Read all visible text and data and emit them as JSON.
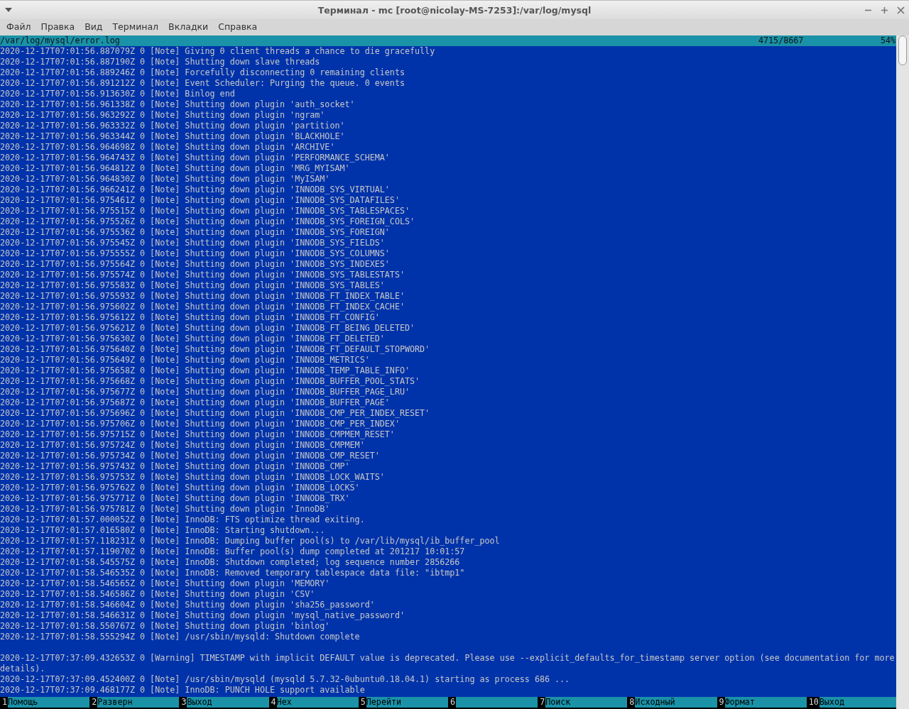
{
  "window": {
    "title": "Терминал - mc [root@nicolay-MS-7253]:/var/log/mysql"
  },
  "menu": [
    "Файл",
    "Правка",
    "Вид",
    "Терминал",
    "Вкладки",
    "Справка"
  ],
  "viewer_header": {
    "path": "/var/log/mysql/error.log",
    "position": "4715/8667",
    "percent": "54%"
  },
  "lines": [
    {
      "kind": "line",
      "text": "2020-12-17T07:01:56.887079Z 0 [Note] Giving 0 client threads a chance to die gracefully"
    },
    {
      "kind": "line",
      "text": "2020-12-17T07:01:56.887190Z 0 [Note] Shutting down slave threads"
    },
    {
      "kind": "line",
      "text": "2020-12-17T07:01:56.889246Z 0 [Note] Forcefully disconnecting 0 remaining clients"
    },
    {
      "kind": "line",
      "text": "2020-12-17T07:01:56.891212Z 0 [Note] Event Scheduler: Purging the queue. 0 events"
    },
    {
      "kind": "line",
      "text": "2020-12-17T07:01:56.913630Z 0 [Note] Binlog end"
    },
    {
      "kind": "line",
      "text": "2020-12-17T07:01:56.961338Z 0 [Note] Shutting down plugin 'auth_socket'"
    },
    {
      "kind": "line",
      "text": "2020-12-17T07:01:56.963292Z 0 [Note] Shutting down plugin 'ngram'"
    },
    {
      "kind": "line",
      "text": "2020-12-17T07:01:56.963332Z 0 [Note] Shutting down plugin 'partition'"
    },
    {
      "kind": "line",
      "text": "2020-12-17T07:01:56.963344Z 0 [Note] Shutting down plugin 'BLACKHOLE'"
    },
    {
      "kind": "line",
      "text": "2020-12-17T07:01:56.964698Z 0 [Note] Shutting down plugin 'ARCHIVE'"
    },
    {
      "kind": "line",
      "text": "2020-12-17T07:01:56.964743Z 0 [Note] Shutting down plugin 'PERFORMANCE_SCHEMA'"
    },
    {
      "kind": "line",
      "text": "2020-12-17T07:01:56.964812Z 0 [Note] Shutting down plugin 'MRG_MYISAM'"
    },
    {
      "kind": "line",
      "text": "2020-12-17T07:01:56.964830Z 0 [Note] Shutting down plugin 'MyISAM'"
    },
    {
      "kind": "line",
      "text": "2020-12-17T07:01:56.966241Z 0 [Note] Shutting down plugin 'INNODB_SYS_VIRTUAL'"
    },
    {
      "kind": "line",
      "text": "2020-12-17T07:01:56.975461Z 0 [Note] Shutting down plugin 'INNODB_SYS_DATAFILES'"
    },
    {
      "kind": "line",
      "text": "2020-12-17T07:01:56.975515Z 0 [Note] Shutting down plugin 'INNODB_SYS_TABLESPACES'"
    },
    {
      "kind": "line",
      "text": "2020-12-17T07:01:56.975526Z 0 [Note] Shutting down plugin 'INNODB_SYS_FOREIGN_COLS'"
    },
    {
      "kind": "line",
      "text": "2020-12-17T07:01:56.975536Z 0 [Note] Shutting down plugin 'INNODB_SYS_FOREIGN'"
    },
    {
      "kind": "line",
      "text": "2020-12-17T07:01:56.975545Z 0 [Note] Shutting down plugin 'INNODB_SYS_FIELDS'"
    },
    {
      "kind": "line",
      "text": "2020-12-17T07:01:56.975555Z 0 [Note] Shutting down plugin 'INNODB_SYS_COLUMNS'"
    },
    {
      "kind": "line",
      "text": "2020-12-17T07:01:56.975564Z 0 [Note] Shutting down plugin 'INNODB_SYS_INDEXES'"
    },
    {
      "kind": "line",
      "text": "2020-12-17T07:01:56.975574Z 0 [Note] Shutting down plugin 'INNODB_SYS_TABLESTATS'"
    },
    {
      "kind": "line",
      "text": "2020-12-17T07:01:56.975583Z 0 [Note] Shutting down plugin 'INNODB_SYS_TABLES'"
    },
    {
      "kind": "line",
      "text": "2020-12-17T07:01:56.975593Z 0 [Note] Shutting down plugin 'INNODB_FT_INDEX_TABLE'"
    },
    {
      "kind": "line",
      "text": "2020-12-17T07:01:56.975602Z 0 [Note] Shutting down plugin 'INNODB_FT_INDEX_CACHE'"
    },
    {
      "kind": "line",
      "text": "2020-12-17T07:01:56.975612Z 0 [Note] Shutting down plugin 'INNODB_FT_CONFIG'"
    },
    {
      "kind": "line",
      "text": "2020-12-17T07:01:56.975621Z 0 [Note] Shutting down plugin 'INNODB_FT_BEING_DELETED'"
    },
    {
      "kind": "line",
      "text": "2020-12-17T07:01:56.975630Z 0 [Note] Shutting down plugin 'INNODB_FT_DELETED'"
    },
    {
      "kind": "line",
      "text": "2020-12-17T07:01:56.975640Z 0 [Note] Shutting down plugin 'INNODB_FT_DEFAULT_STOPWORD'"
    },
    {
      "kind": "line",
      "text": "2020-12-17T07:01:56.975649Z 0 [Note] Shutting down plugin 'INNODB_METRICS'"
    },
    {
      "kind": "line",
      "text": "2020-12-17T07:01:56.975658Z 0 [Note] Shutting down plugin 'INNODB_TEMP_TABLE_INFO'"
    },
    {
      "kind": "line",
      "text": "2020-12-17T07:01:56.975668Z 0 [Note] Shutting down plugin 'INNODB_BUFFER_POOL_STATS'"
    },
    {
      "kind": "line",
      "text": "2020-12-17T07:01:56.975677Z 0 [Note] Shutting down plugin 'INNODB_BUFFER_PAGE_LRU'"
    },
    {
      "kind": "line",
      "text": "2020-12-17T07:01:56.975687Z 0 [Note] Shutting down plugin 'INNODB_BUFFER_PAGE'"
    },
    {
      "kind": "line",
      "text": "2020-12-17T07:01:56.975696Z 0 [Note] Shutting down plugin 'INNODB_CMP_PER_INDEX_RESET'"
    },
    {
      "kind": "line",
      "text": "2020-12-17T07:01:56.975706Z 0 [Note] Shutting down plugin 'INNODB_CMP_PER_INDEX'"
    },
    {
      "kind": "line",
      "text": "2020-12-17T07:01:56.975715Z 0 [Note] Shutting down plugin 'INNODB_CMPMEM_RESET'"
    },
    {
      "kind": "line",
      "text": "2020-12-17T07:01:56.975724Z 0 [Note] Shutting down plugin 'INNODB_CMPMEM'"
    },
    {
      "kind": "line",
      "text": "2020-12-17T07:01:56.975734Z 0 [Note] Shutting down plugin 'INNODB_CMP_RESET'"
    },
    {
      "kind": "line",
      "text": "2020-12-17T07:01:56.975743Z 0 [Note] Shutting down plugin 'INNODB_CMP'"
    },
    {
      "kind": "line",
      "text": "2020-12-17T07:01:56.975753Z 0 [Note] Shutting down plugin 'INNODB_LOCK_WAITS'"
    },
    {
      "kind": "line",
      "text": "2020-12-17T07:01:56.975762Z 0 [Note] Shutting down plugin 'INNODB_LOCKS'"
    },
    {
      "kind": "line",
      "text": "2020-12-17T07:01:56.975771Z 0 [Note] Shutting down plugin 'INNODB_TRX'"
    },
    {
      "kind": "line",
      "text": "2020-12-17T07:01:56.975781Z 0 [Note] Shutting down plugin 'InnoDB'"
    },
    {
      "kind": "line",
      "text": "2020-12-17T07:01:57.000052Z 0 [Note] InnoDB: FTS optimize thread exiting."
    },
    {
      "kind": "line",
      "text": "2020-12-17T07:01:57.016580Z 0 [Note] InnoDB: Starting shutdown..."
    },
    {
      "kind": "line",
      "text": "2020-12-17T07:01:57.118231Z 0 [Note] InnoDB: Dumping buffer pool(s) to /var/lib/mysql/ib_buffer_pool"
    },
    {
      "kind": "line",
      "text": "2020-12-17T07:01:57.119070Z 0 [Note] InnoDB: Buffer pool(s) dump completed at 201217 10:01:57"
    },
    {
      "kind": "line",
      "text": "2020-12-17T07:01:58.545575Z 0 [Note] InnoDB: Shutdown completed; log sequence number 2856266"
    },
    {
      "kind": "line",
      "text": "2020-12-17T07:01:58.546535Z 0 [Note] InnoDB: Removed temporary tablespace data file: \"ibtmp1\""
    },
    {
      "kind": "line",
      "text": "2020-12-17T07:01:58.546565Z 0 [Note] Shutting down plugin 'MEMORY'"
    },
    {
      "kind": "line",
      "text": "2020-12-17T07:01:58.546586Z 0 [Note] Shutting down plugin 'CSV'"
    },
    {
      "kind": "line",
      "text": "2020-12-17T07:01:58.546604Z 0 [Note] Shutting down plugin 'sha256_password'"
    },
    {
      "kind": "line",
      "text": "2020-12-17T07:01:58.546631Z 0 [Note] Shutting down plugin 'mysql_native_password'"
    },
    {
      "kind": "line",
      "text": "2020-12-17T07:01:58.550767Z 0 [Note] Shutting down plugin 'binlog'"
    },
    {
      "kind": "line",
      "text": "2020-12-17T07:01:58.555294Z 0 [Note] /usr/sbin/mysqld: Shutdown complete"
    },
    {
      "kind": "blank"
    },
    {
      "kind": "line",
      "text": "2020-12-17T07:37:09.432653Z 0 [Warning] TIMESTAMP with implicit DEFAULT value is deprecated. Please use --explicit_defaults_for_timestamp server option (see documentation for more"
    },
    {
      "kind": "line",
      "text": "details)."
    },
    {
      "kind": "line",
      "text": "2020-12-17T07:37:09.452400Z 0 [Note] /usr/sbin/mysqld (mysqld 5.7.32-0ubuntu0.18.04.1) starting as process 686 ..."
    },
    {
      "kind": "line",
      "text": "2020-12-17T07:37:09.468177Z 0 [Note] InnoDB: PUNCH HOLE support available"
    }
  ],
  "function_keys": [
    {
      "number": "1",
      "label": "Помощь"
    },
    {
      "number": "2",
      "label": "Разверн"
    },
    {
      "number": "3",
      "label": "Выход"
    },
    {
      "number": "4",
      "label": "Hex"
    },
    {
      "number": "5",
      "label": "Перейти"
    },
    {
      "number": "6"
    },
    {
      "number": "7",
      "label": "Поиск"
    },
    {
      "number": "8",
      "label": "Исходный"
    },
    {
      "number": "9",
      "label": "Формат"
    },
    {
      "number": "10",
      "label": "Выход"
    }
  ]
}
